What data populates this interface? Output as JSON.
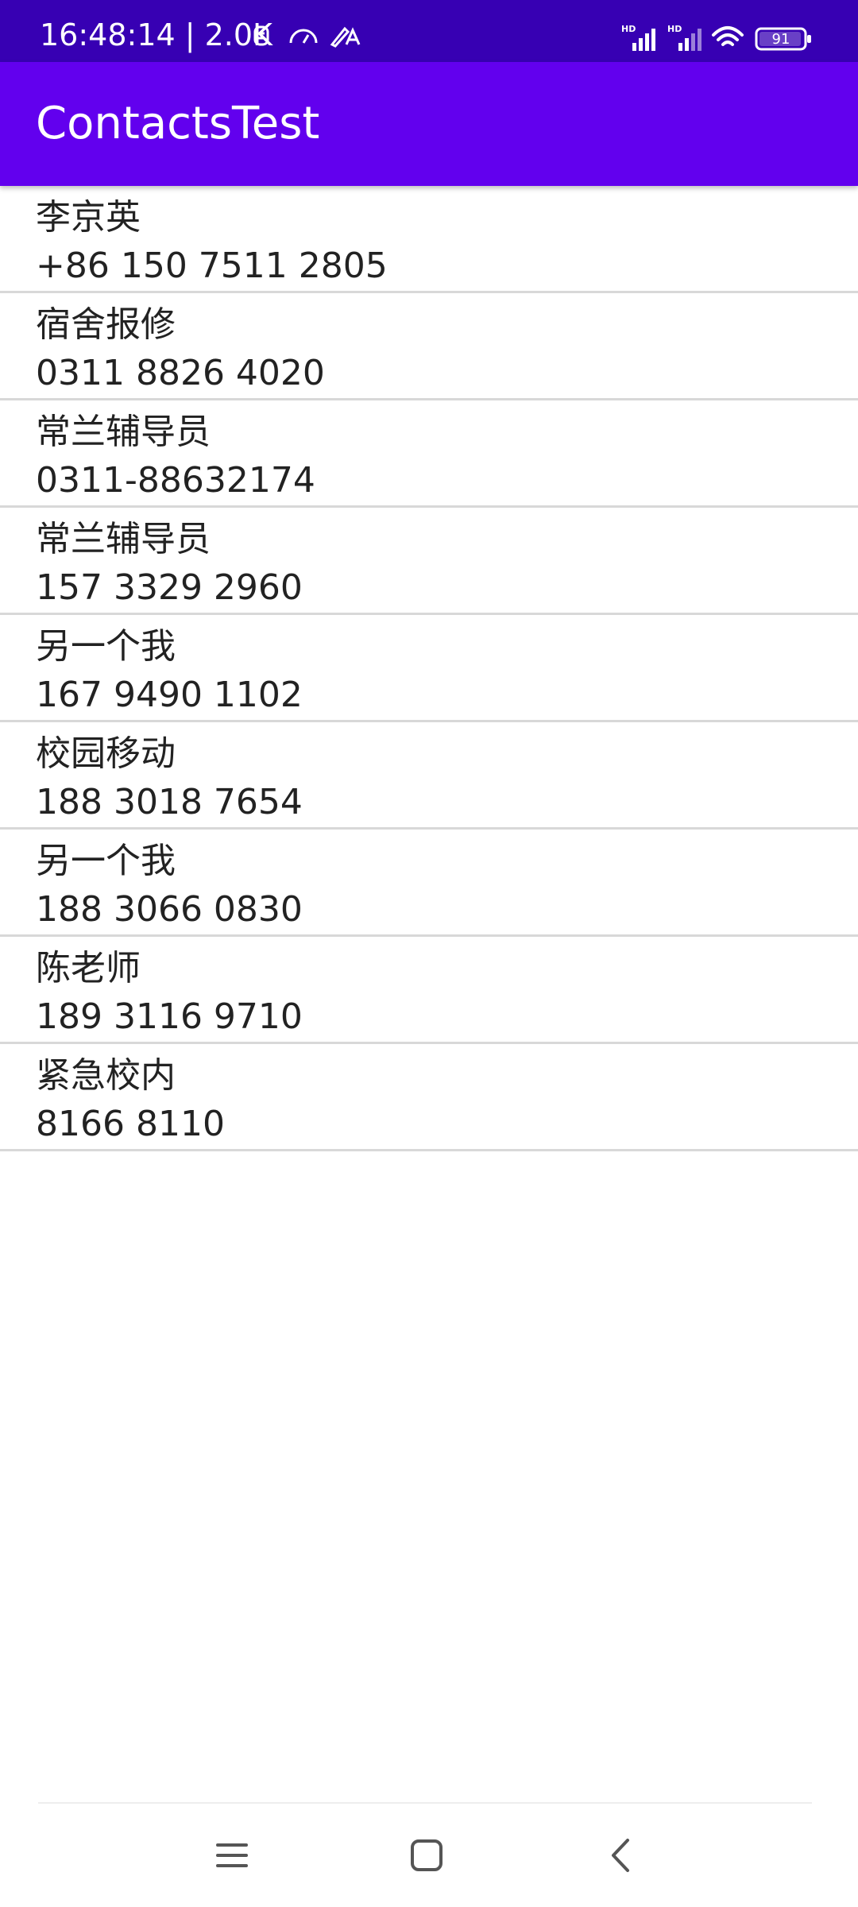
{
  "status_bar": {
    "time_and_speed": "16:48:14 | 2.0K",
    "battery": "91",
    "icons": [
      "notification-icon",
      "speedometer-icon",
      "pen-icon",
      "hd-signal-icon",
      "hd-signal-icon",
      "wifi-icon",
      "battery-icon"
    ]
  },
  "app_bar": {
    "title": "ContactsTest"
  },
  "contacts": [
    {
      "name": "李京英",
      "number": "+86 150 7511 2805"
    },
    {
      "name": "宿舍报修",
      "number": "0311 8826 4020"
    },
    {
      "name": "常兰辅导员",
      "number": "0311-88632174"
    },
    {
      "name": "常兰辅导员",
      "number": "157 3329 2960"
    },
    {
      "name": "另一个我",
      "number": "167 9490 1102"
    },
    {
      "name": "校园移动",
      "number": "188 3018 7654"
    },
    {
      "name": "另一个我",
      "number": "188 3066 0830"
    },
    {
      "name": "陈老师",
      "number": "189 3116 9710"
    },
    {
      "name": "紧急校内",
      "number": "8166 8110"
    }
  ],
  "nav_bar": {
    "icons": [
      "menu-icon",
      "home-icon",
      "back-icon"
    ]
  }
}
